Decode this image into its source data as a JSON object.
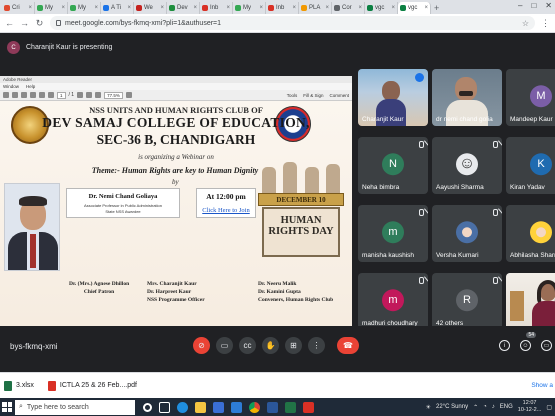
{
  "browser": {
    "tabs": [
      {
        "label": "Cri",
        "color": "#e04a2f"
      },
      {
        "label": "My",
        "color": "#34a853"
      },
      {
        "label": "My",
        "color": "#34a853"
      },
      {
        "label": "A Ti",
        "color": "#1a73e8"
      },
      {
        "label": "We",
        "color": "#c5221f"
      },
      {
        "label": "Dev",
        "color": "#1e8e3e"
      },
      {
        "label": "Inb",
        "color": "#d93025"
      },
      {
        "label": "My",
        "color": "#34a853"
      },
      {
        "label": "Inb",
        "color": "#d93025"
      },
      {
        "label": "PLA",
        "color": "#f29900"
      },
      {
        "label": "Cor",
        "color": "#5f6368"
      },
      {
        "label": "vgc",
        "color": "#0b8043"
      },
      {
        "label": "vgc",
        "color": "#0b8043",
        "active": true
      }
    ],
    "url": "meet.google.com/bys-fkmq-xmi?pli=1&authuser=1"
  },
  "meet": {
    "presenter_initial": "C",
    "presenting_text": "Charanjit Kaur is presenting",
    "meeting_code": "bys-fkmq-xmi",
    "participant_count": "54"
  },
  "pdf": {
    "title": "Adobe Reader",
    "menu": [
      "Window",
      "Help"
    ],
    "page_current": "1",
    "page_total": "/ 1",
    "zoom": "77.5%",
    "toolbar_right": [
      "Tools",
      "Fill & Sign",
      "Comment"
    ]
  },
  "poster": {
    "line1": "NSS UNITS AND HUMAN RIGHTS CLUB OF",
    "line2": "DEV SAMAJ COLLEGE OF EDUCATION,",
    "line3": "SEC-36 B, CHANDIGARH",
    "line4": "is organizing a Webinar on",
    "theme": "Theme:- Human Rights are key to Human Dignity",
    "by": "by",
    "speaker_name": "Dr. Nemi Chand Goliaya",
    "speaker_desc1": "Associate Professor in Public Administration",
    "speaker_desc2": "State NSS Awardee",
    "time": "At 12:00 pm",
    "link": "Click Here to Join",
    "date_banner": "DECEMBER 10",
    "day_title": "HUMAN RIGHTS DAY",
    "credits": [
      {
        "l1": "Dr. (Mrs.) Agnese Dhillon",
        "l2": "Chief Patron"
      },
      {
        "l1": "Mrs. Charanjit Kaur",
        "l2": "Dr. Harpreet Kaur",
        "l3": "NSS Programme Officer"
      },
      {
        "l1": "Dr. Neeru Malik",
        "l2": "Dr. Kamini Gupta",
        "l3": "Conveners, Human Rights Club"
      }
    ]
  },
  "participants": [
    {
      "name": "Charanjit Kaur",
      "type": "camera",
      "speaking": true
    },
    {
      "name": "dr nemi chand golia",
      "type": "camera"
    },
    {
      "name": "Mandeep Kaur",
      "initial": "M",
      "color": "#7b5ea7"
    },
    {
      "name": "Neha bimbra",
      "initial": "N",
      "color": "#2f7d5b"
    },
    {
      "name": "Aayushi Sharma",
      "initial": "",
      "color": "#e8eaed",
      "emoji": "☺"
    },
    {
      "name": "Kiran Yadav",
      "initial": "K",
      "color": "#1f6bb0"
    },
    {
      "name": "manisha kaushish",
      "initial": "m",
      "color": "#2f7d5b"
    },
    {
      "name": "Versha Kumari",
      "initial": "",
      "color": "#4a6fa5"
    },
    {
      "name": "Abhilasha Sharma",
      "initial": "",
      "color": "#ffd23a"
    },
    {
      "name": "madhuri choudhary",
      "initial": "m",
      "color": "#c2185b"
    },
    {
      "name": "42 others",
      "initial": "R",
      "color": "#5f6368"
    },
    {
      "name": "",
      "type": "self"
    }
  ],
  "downloads": [
    {
      "name": "3.xlsx",
      "color": "#1e7145"
    },
    {
      "name": "ICTLA 25 & 26 Feb....pdf",
      "color": "#d93025"
    }
  ],
  "downloads_show_all": "Show a",
  "taskbar": {
    "search_placeholder": "Type here to search",
    "weather": "22°C  Sunny",
    "lang": "ENG",
    "time": "12:07",
    "date": "10-12-2..."
  }
}
